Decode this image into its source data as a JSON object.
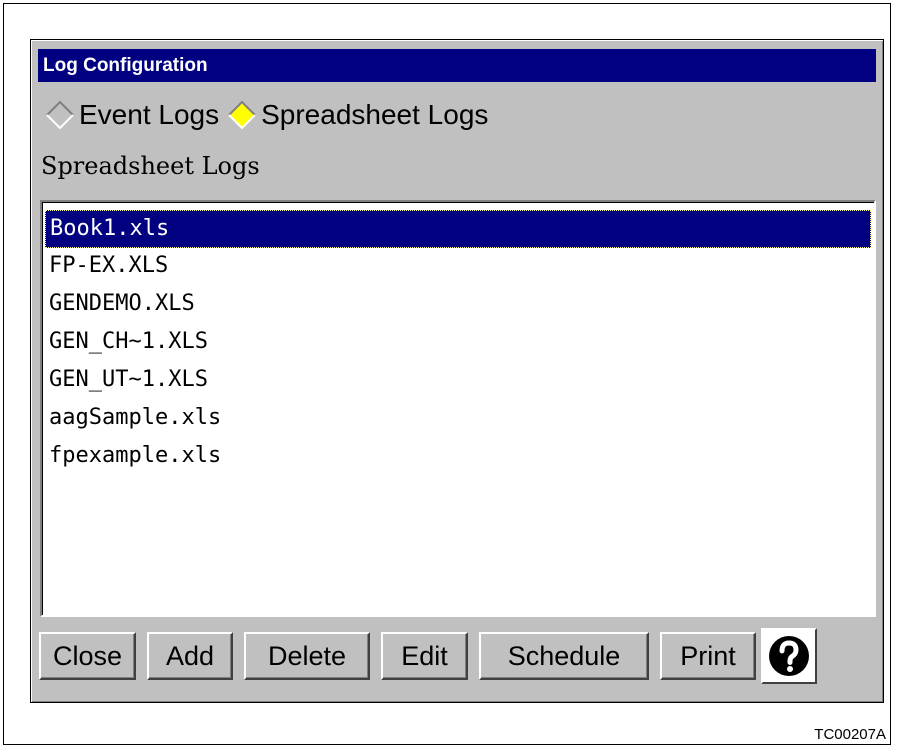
{
  "window": {
    "title": "Log Configuration"
  },
  "log_type": {
    "options": [
      {
        "label": "Event Logs",
        "selected": false
      },
      {
        "label": "Spreadsheet Logs",
        "selected": true
      }
    ]
  },
  "list": {
    "heading": "Spreadsheet Logs",
    "items": [
      {
        "label": "Book1.xls",
        "selected": true
      },
      {
        "label": "FP-EX.XLS",
        "selected": false
      },
      {
        "label": "GENDEMO.XLS",
        "selected": false
      },
      {
        "label": "GEN_CH~1.XLS",
        "selected": false
      },
      {
        "label": "GEN_UT~1.XLS",
        "selected": false
      },
      {
        "label": "aagSample.xls",
        "selected": false
      },
      {
        "label": "fpexample.xls",
        "selected": false
      }
    ]
  },
  "buttons": {
    "close": "Close",
    "add": "Add",
    "delete": "Delete",
    "edit": "Edit",
    "schedule": "Schedule",
    "print": "Print",
    "help_icon": "question-mark-circle-icon"
  },
  "figure_id": "TC00207A",
  "colors": {
    "title_bar": "#000080",
    "window_bg": "#c0c0c0",
    "selected_radio": "#ffff00",
    "selection": "#000080"
  }
}
